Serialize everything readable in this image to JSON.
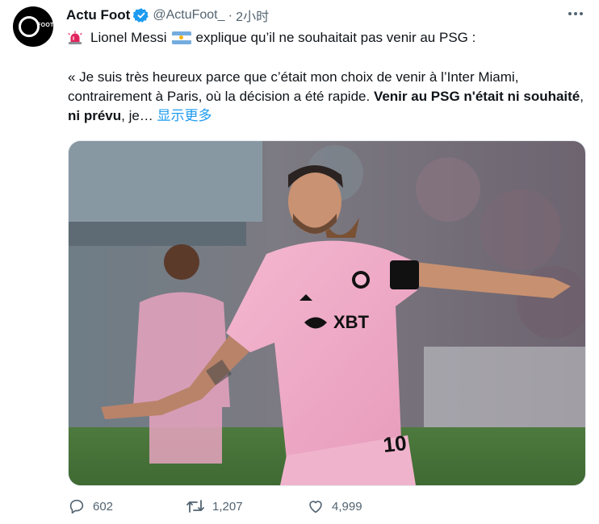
{
  "tweet": {
    "author_name": "Actu Foot",
    "avatar_text": "FOOT",
    "handle": "@ActuFoot_",
    "separator": "·",
    "time": "2小时",
    "line1_before_flag": "Lionel Messi",
    "line1_after_flag": "explique qu’il ne souhaitait pas venir au PSG :",
    "quote_part1": "« Je suis très heureux parce que c’était mon choix de venir à l’Inter Miami, contrairement à Paris, où la décision a été rapide. ",
    "quote_bold1": "Venir au PSG n'était ni souhaité",
    "quote_part2": ", ",
    "quote_bold2": "ni prévu",
    "quote_part3": ", je… ",
    "show_more": "显示更多",
    "jersey_sponsor": "XBT",
    "jersey_number": "10",
    "accent_color": "#1d9bf0"
  },
  "actions": {
    "replies": "602",
    "retweets": "1,207",
    "likes": "4,999"
  },
  "icons": [
    "siren-icon",
    "argentina-flag-icon",
    "verified-badge-icon",
    "more-options-icon",
    "reply-icon",
    "retweet-icon",
    "like-icon"
  ]
}
